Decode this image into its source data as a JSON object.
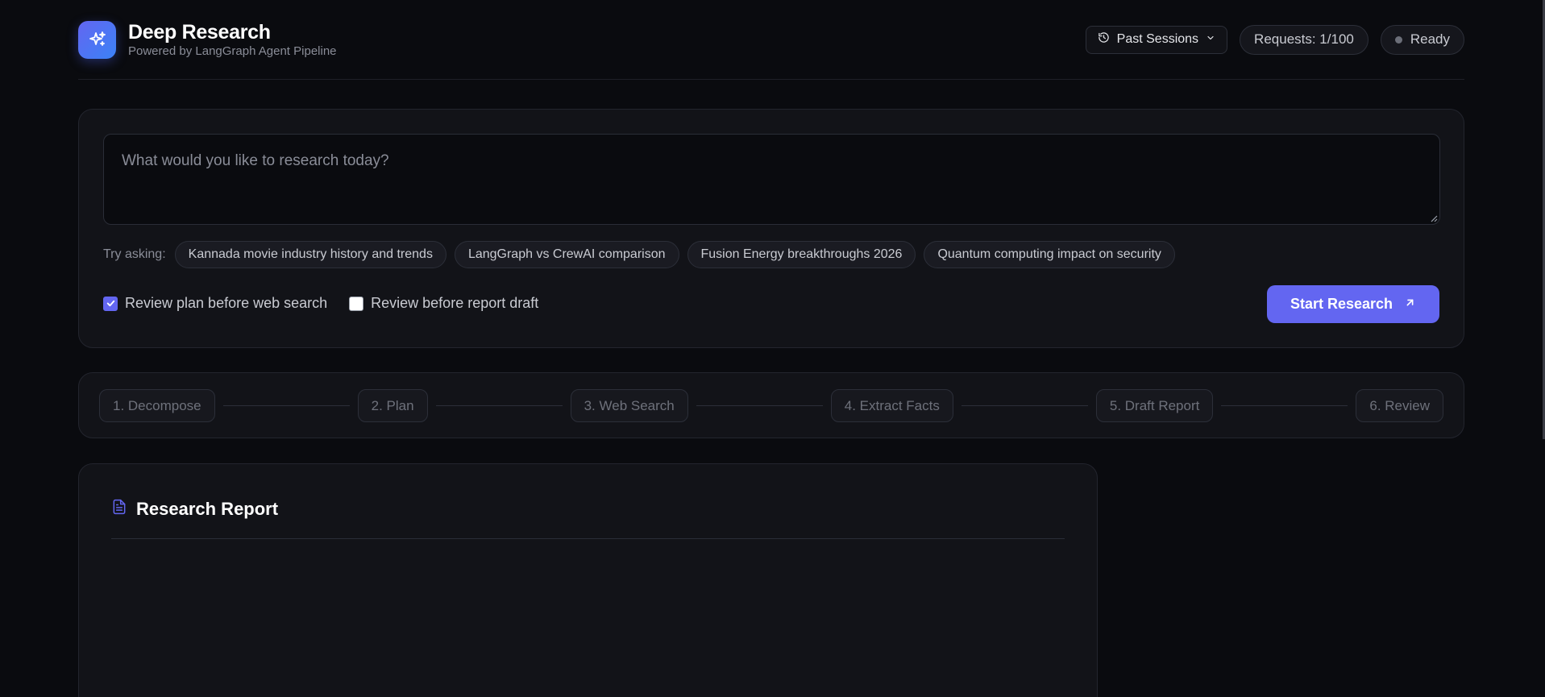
{
  "header": {
    "title": "Deep Research",
    "subtitle": "Powered by LangGraph Agent Pipeline",
    "sessions_label": "Past Sessions",
    "requests_label": "Requests: 1/100",
    "status_label": "Ready"
  },
  "search": {
    "placeholder": "What would you like to research today?",
    "value": ""
  },
  "suggestions": {
    "label": "Try asking:",
    "items": [
      "Kannada movie industry history and trends",
      "LangGraph vs CrewAI comparison",
      "Fusion Energy breakthroughs 2026",
      "Quantum computing impact on security"
    ]
  },
  "options": {
    "review_plan": {
      "label": "Review plan before web search",
      "checked": true
    },
    "review_report": {
      "label": "Review before report draft",
      "checked": false
    }
  },
  "start_label": "Start Research",
  "pipeline": {
    "steps": [
      "1. Decompose",
      "2. Plan",
      "3. Web Search",
      "4. Extract Facts",
      "5. Draft Report",
      "6. Review"
    ]
  },
  "report": {
    "title": "Research Report"
  },
  "colors": {
    "accent": "#6366f1",
    "background": "#0a0b0f",
    "card": "#121318"
  },
  "icons": {
    "logo": "sparkles-icon",
    "sessions": "history-icon",
    "dropdown": "chevron-down-icon",
    "start": "arrow-up-right-icon",
    "report": "document-icon"
  }
}
